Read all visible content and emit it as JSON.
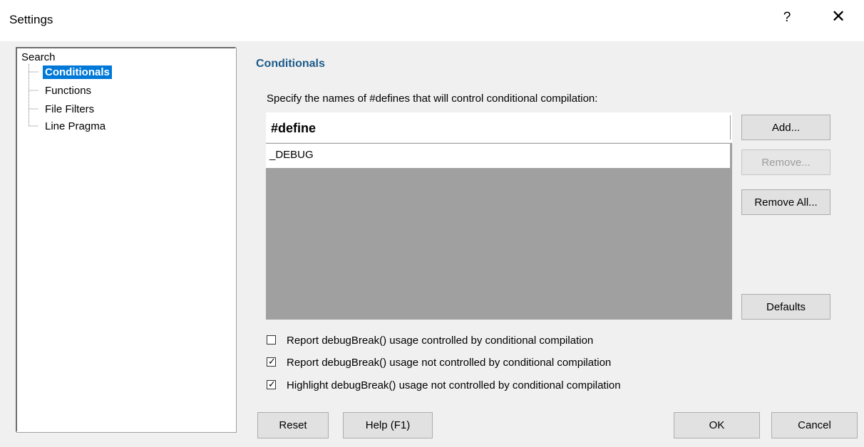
{
  "window": {
    "title": "Settings",
    "help_label": "?",
    "close_label": "✕"
  },
  "tree": {
    "root": "Search",
    "items": [
      {
        "label": "Conditionals",
        "selected": true
      },
      {
        "label": "Functions",
        "selected": false
      },
      {
        "label": "File Filters",
        "selected": false
      },
      {
        "label": "Line Pragma",
        "selected": false
      }
    ]
  },
  "main": {
    "section_title": "Conditionals",
    "instruction": "Specify the names of #defines that will control conditional compilation:",
    "list": {
      "column_header": "#define",
      "rows": [
        "_DEBUG"
      ]
    },
    "buttons": {
      "add": "Add...",
      "remove": "Remove...",
      "remove_all": "Remove All...",
      "defaults": "Defaults"
    },
    "options": [
      {
        "label": "Report debugBreak() usage controlled by conditional compilation",
        "checked": false
      },
      {
        "label": "Report debugBreak() usage not controlled by conditional compilation",
        "checked": true
      },
      {
        "label": "Highlight debugBreak() usage not controlled by conditional compilation",
        "checked": true
      }
    ]
  },
  "footer": {
    "reset": "Reset",
    "help": "Help (F1)",
    "ok": "OK",
    "cancel": "Cancel"
  },
  "colors": {
    "selection": "#0078d7",
    "section_title": "#1c5b8a",
    "list_empty_area": "#a0a0a0"
  }
}
